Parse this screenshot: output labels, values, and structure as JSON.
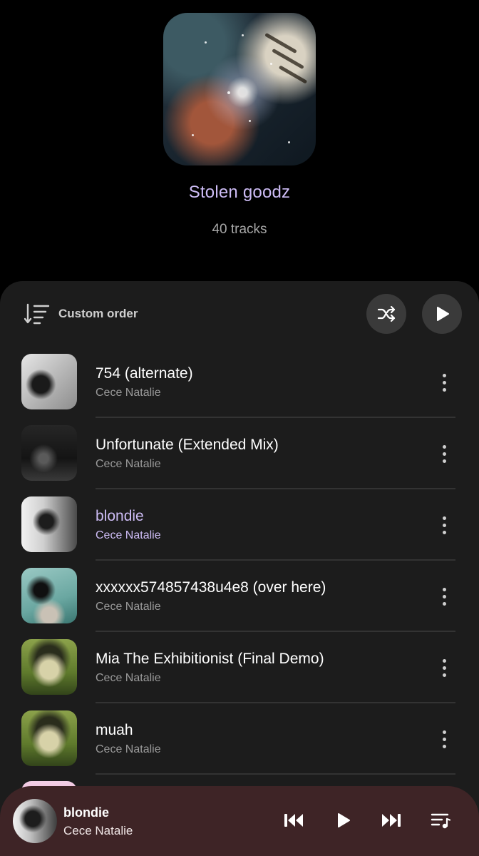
{
  "header": {
    "title": "Stolen goodz",
    "track_count": "40 tracks"
  },
  "toolbar": {
    "sort_label": "Custom order",
    "icons": [
      "sort-icon",
      "shuffle-icon",
      "play-icon"
    ]
  },
  "tracks": [
    {
      "title": "754 (alternate)",
      "artist": "Cece Natalie",
      "active": false
    },
    {
      "title": "Unfortunate (Extended Mix)",
      "artist": "Cece Natalie",
      "active": false
    },
    {
      "title": "blondie",
      "artist": "Cece Natalie",
      "active": true
    },
    {
      "title": "xxxxxx574857438u4e8 (over here)",
      "artist": "Cece Natalie",
      "active": false
    },
    {
      "title": "Mia The Exhibitionist (Final Demo)",
      "artist": "Cece Natalie",
      "active": false
    },
    {
      "title": "muah",
      "artist": "Cece Natalie",
      "active": false
    }
  ],
  "now_playing": {
    "title": "blondie",
    "artist": "Cece Natalie",
    "icons": [
      "previous-icon",
      "play-icon",
      "next-icon",
      "queue-icon"
    ]
  },
  "colors": {
    "accent": "#cdbcf5",
    "sheet": "#1c1c1c",
    "mini_player": "#3e2426"
  }
}
